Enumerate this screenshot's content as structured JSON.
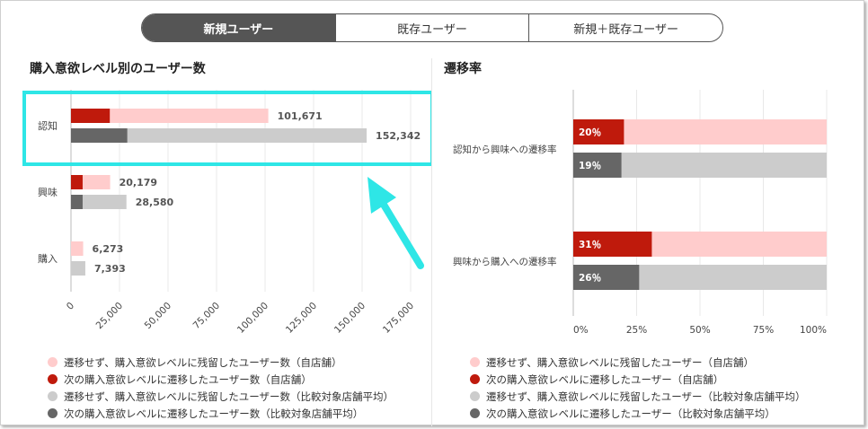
{
  "tabs": [
    {
      "label": "新規ユーザー",
      "active": true
    },
    {
      "label": "既存ユーザー",
      "active": false
    },
    {
      "label": "新規＋既存ユーザー",
      "active": false
    }
  ],
  "left": {
    "title": "購入意欲レベル別のユーザー数",
    "chart_data": {
      "type": "bar",
      "orientation": "horizontal",
      "categories": [
        "認知",
        "興味",
        "購入"
      ],
      "series": [
        {
          "role": "self",
          "segments": [
            {
              "transitioned": 20000,
              "stayed": 101671,
              "label": "101,671"
            },
            {
              "transitioned": 6000,
              "stayed": 20179,
              "label": "20,179"
            },
            {
              "transitioned": 0,
              "stayed": 6273,
              "label": "6,273"
            }
          ]
        },
        {
          "role": "comparison",
          "segments": [
            {
              "transitioned": 29000,
              "stayed": 152342,
              "label": "152,342"
            },
            {
              "transitioned": 6000,
              "stayed": 28580,
              "label": "28,580"
            },
            {
              "transitioned": 0,
              "stayed": 7393,
              "label": "7,393"
            }
          ]
        }
      ],
      "xlim": [
        0,
        175000
      ],
      "xticks": [
        "0",
        "25,000",
        "50,000",
        "75,000",
        "100,000",
        "125,000",
        "150,000",
        "175,000"
      ],
      "grid": true
    },
    "legend": [
      {
        "label": "遷移せず、購入意欲レベルに残留したユーザー数（自店舗）",
        "color": "#ffcccc"
      },
      {
        "label": "次の購入意欲レベルに遷移したユーザー数（自店舗）",
        "color": "#bf1a0c"
      },
      {
        "label": "遷移せず、購入意欲レベルに残留したユーザー数（比較対象店舗平均）",
        "color": "#cccccc"
      },
      {
        "label": "次の購入意欲レベルに遷移したユーザー数（比較対象店舗平均）",
        "color": "#666666"
      }
    ]
  },
  "right": {
    "title": "遷移率",
    "chart_data": {
      "type": "bar",
      "orientation": "horizontal",
      "stacked_percent": true,
      "categories": [
        "認知から興味への遷移率",
        "興味から購入への遷移率"
      ],
      "series": [
        {
          "role": "self",
          "values": [
            20,
            31
          ],
          "labels": [
            "20％",
            "31％"
          ]
        },
        {
          "role": "comparison",
          "values": [
            19,
            26
          ],
          "labels": [
            "19％",
            "26％"
          ]
        }
      ],
      "xlim": [
        0,
        100
      ],
      "xticks": [
        "0%",
        "25%",
        "50%",
        "75%",
        "100%"
      ],
      "grid": true
    },
    "legend": [
      {
        "label": "遷移せず、購入意欲レベルに残留したユーザー（自店舗）",
        "color": "#ffcccc"
      },
      {
        "label": "次の購入意欲レベルに遷移したユーザー（自店舗）",
        "color": "#bf1a0c"
      },
      {
        "label": "遷移せず、購入意欲レベルに残留したユーザー（比較対象店舗平均）",
        "color": "#cccccc"
      },
      {
        "label": "次の購入意欲レベルに遷移したユーザー（比較対象店舗平均）",
        "color": "#666666"
      }
    ]
  },
  "colors": {
    "self_stay": "#ffcccc",
    "self_move": "#bf1a0c",
    "comp_stay": "#cccccc",
    "comp_move": "#666666",
    "highlight": "#2ee6e6"
  }
}
